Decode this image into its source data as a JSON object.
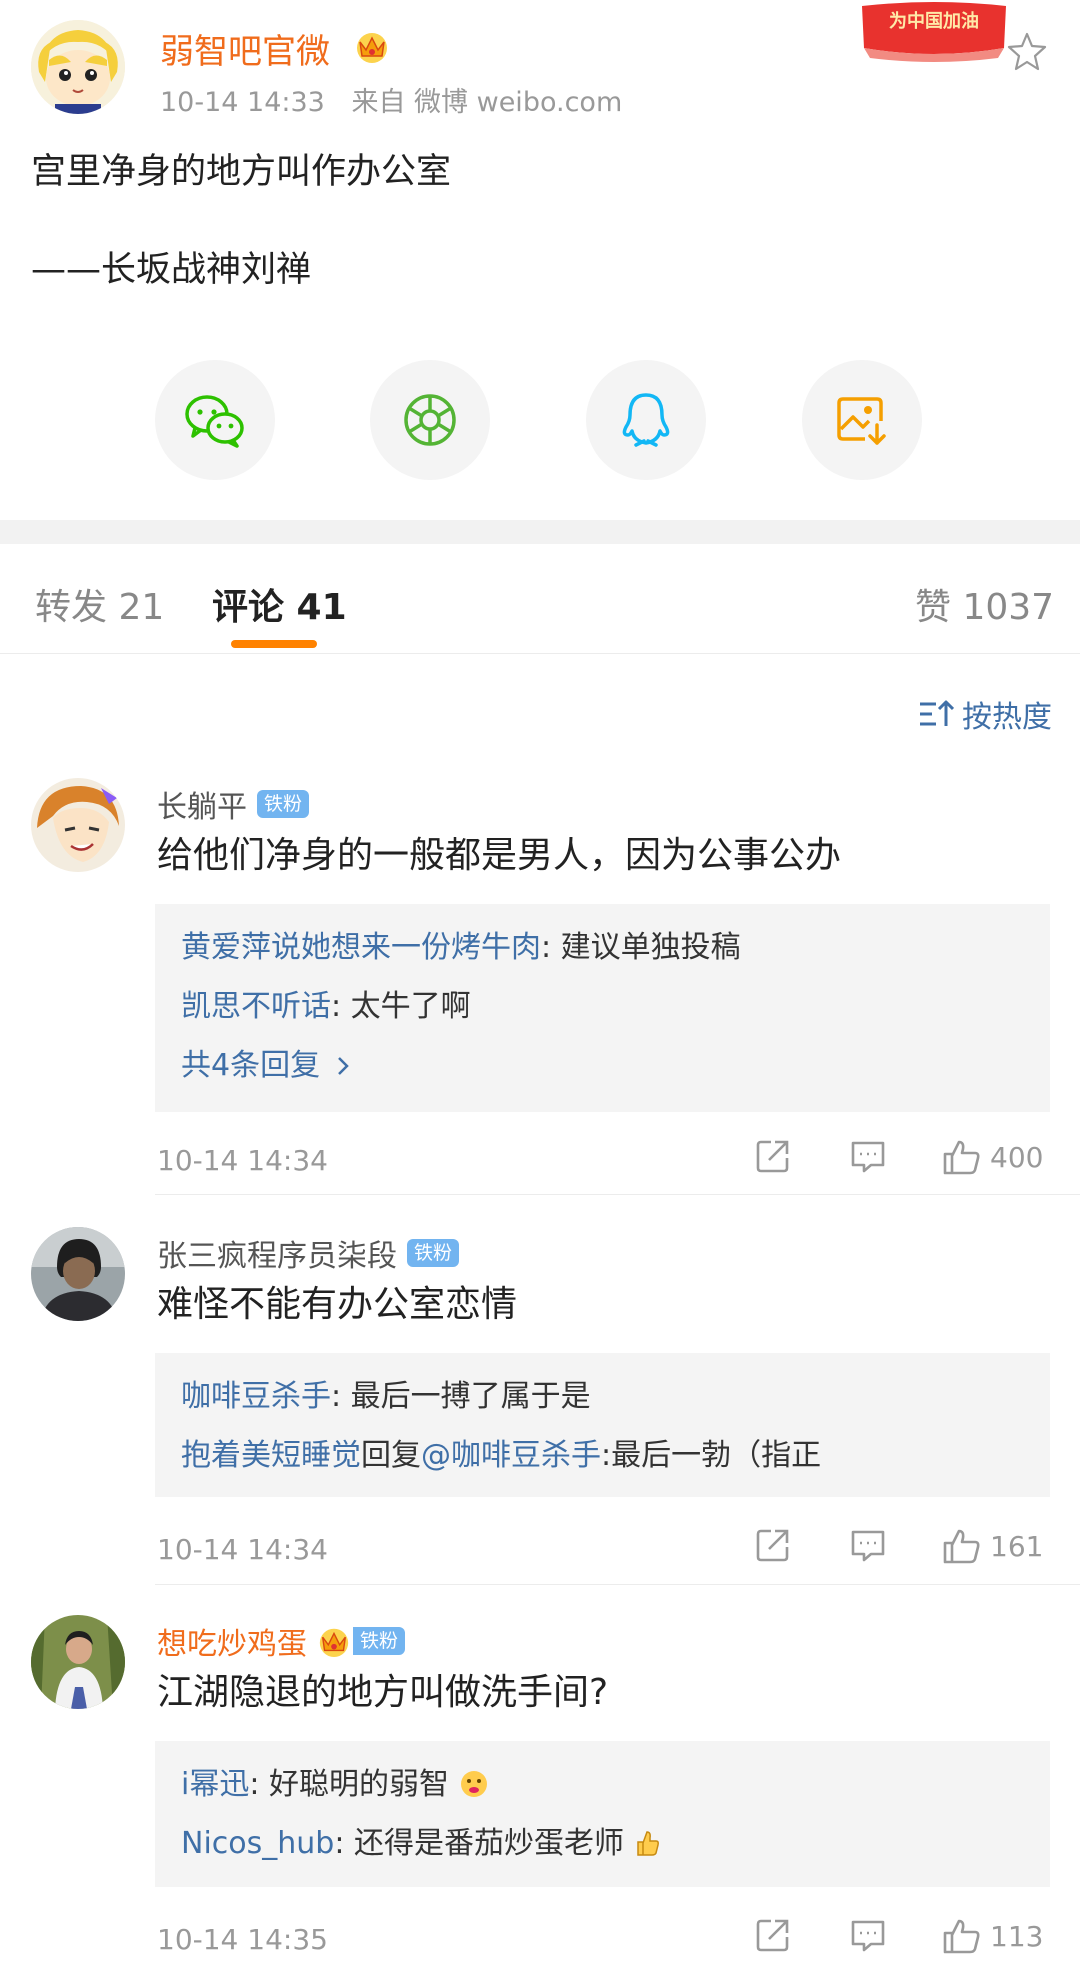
{
  "post": {
    "author": "弱智吧官微",
    "time": "10-14 14:33",
    "source": "来自 微博 weibo.com",
    "text": "宫里净身的地方叫作办公室",
    "signature": "——长坂战神刘禅",
    "promo": "为中国加油"
  },
  "share": [
    "wechat-icon",
    "moments-icon",
    "qq-icon",
    "save-image-icon"
  ],
  "tabs": {
    "repost": "转发 21",
    "comments": "评论 41",
    "likes": "赞 1037"
  },
  "sort": {
    "label": "按热度"
  },
  "colors": {
    "accent": "#ff8200",
    "link": "#3f6fa7",
    "vip_name": "#f06c1c",
    "fan_badge": "#72b4f0"
  },
  "comments": [
    {
      "name": "长躺平",
      "badge": "铁粉",
      "text": "给他们净身的一般都是男人，因为公事公办",
      "replies": [
        {
          "user": "黄爱萍说她想来一份烤牛肉",
          "sep": ": ",
          "text": "建议单独投稿"
        },
        {
          "user": "凯思不听话",
          "sep": ": ",
          "text": "太牛了啊"
        }
      ],
      "more": "共4条回复",
      "time": "10-14 14:34",
      "likes": "400"
    },
    {
      "name": "张三疯程序员柒段",
      "badge": "铁粉",
      "text": "难怪不能有办公室恋情",
      "replies": [
        {
          "user": "咖啡豆杀手",
          "sep": ": ",
          "text": "最后一搏了属于是"
        },
        {
          "user": "抱着美短睡觉",
          "mid": "回复",
          "mention": "@咖啡豆杀手",
          "text": ":最后一勃（指正"
        }
      ],
      "time": "10-14 14:34",
      "likes": "161"
    },
    {
      "name": "想吃炒鸡蛋",
      "badge": "铁粉",
      "text": "江湖隐退的地方叫做洗手间?",
      "replies": [
        {
          "user": "i幂迅",
          "sep": ": ",
          "text": "好聪明的弱智"
        },
        {
          "user": "Nicos_hub",
          "sep": ": ",
          "text": "还得是番茄炒蛋老师"
        }
      ],
      "time": "10-14 14:35",
      "likes": "113"
    }
  ]
}
